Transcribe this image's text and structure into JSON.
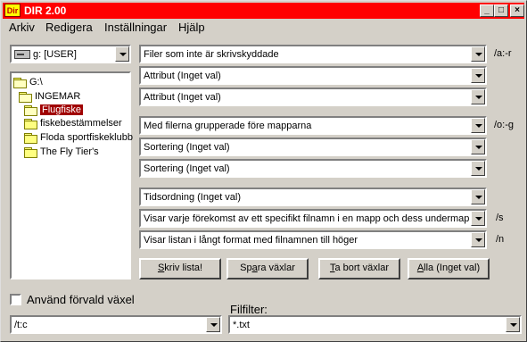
{
  "window": {
    "title": "DIR 2.00",
    "icon_text": "Dir"
  },
  "titlebar_buttons": {
    "minimize": "_",
    "maximize": "□",
    "close": "×"
  },
  "menu": [
    "Arkiv",
    "Redigera",
    "Inställningar",
    "Hjälp"
  ],
  "drive": {
    "value": "g: [USER]"
  },
  "tree": [
    {
      "label": "G:\\"
    },
    {
      "label": "INGEMAR"
    },
    {
      "label": "Flugfiske"
    },
    {
      "label": "fiskebestämmelser"
    },
    {
      "label": "Floda sportfiskeklubb"
    },
    {
      "label": "The Fly Tier's"
    }
  ],
  "attributes": {
    "a1": "Filer som inte är skrivskyddade",
    "a2": "Attribut (Inget val)",
    "a3": "Attribut (Inget val)",
    "switch": "/a:-r"
  },
  "sorting": {
    "s1": "Med filerna grupperade före mapparna",
    "s2": "Sortering (Inget val)",
    "s3": "Sortering (Inget val)",
    "switch": "/o:-g"
  },
  "time": {
    "value": "Tidsordning (Inget val)"
  },
  "recursive": {
    "value": "Visar varje förekomst av ett specifikt filnamn i en mapp och dess undermappar",
    "switch": "/s"
  },
  "format": {
    "value": "Visar listan i långt format med filnamnen till höger",
    "switch": "/n"
  },
  "buttons": {
    "print_pre": "",
    "print_u": "S",
    "print_post": "kriv lista!",
    "save_pre": "Sp",
    "save_u": "a",
    "save_post": "ra växlar",
    "delete_pre": "",
    "delete_u": "T",
    "delete_post": "a bort växlar",
    "all_pre": "",
    "all_u": "A",
    "all_post": "lla (Inget val)"
  },
  "default_switch": {
    "label": "Använd förvald växel",
    "checked": false,
    "value": "/t:c"
  },
  "filefilter": {
    "label": "Filfilter:",
    "value": "*.txt"
  }
}
